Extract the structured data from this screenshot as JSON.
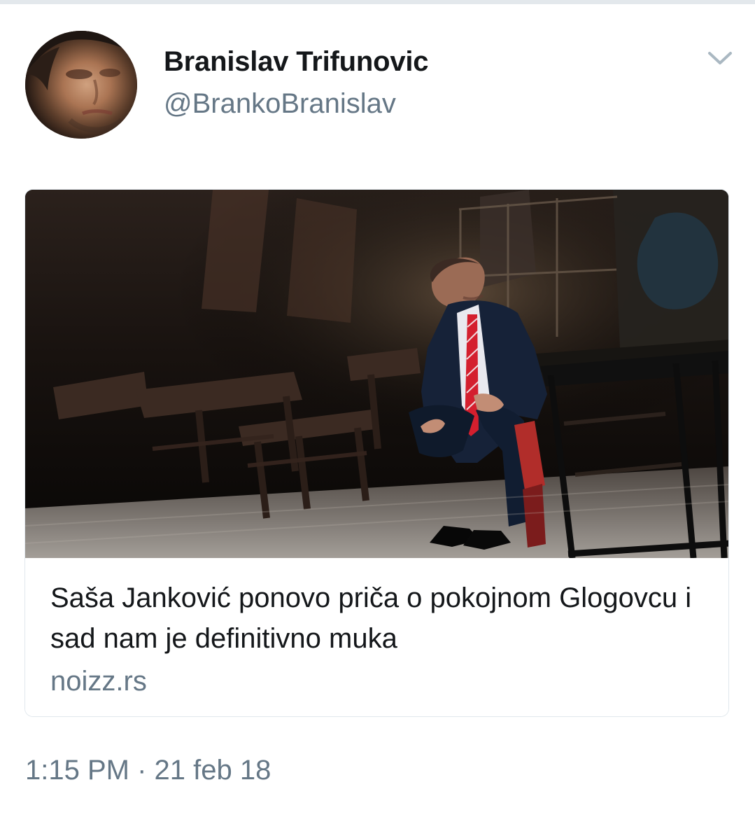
{
  "tweet": {
    "author": {
      "name": "Branislav Trifunovic",
      "handle": "@BrankoBranislav",
      "avatar_icon": "user-avatar"
    },
    "menu_icon": "chevron-down-icon",
    "link_card": {
      "title": "Saša Janković ponovo priča o pokojnom Glogovcu i sad nam je definitivno muka",
      "domain": "noizz.rs",
      "image_icon": "article-photo"
    },
    "timestamp": "1:15 PM · 21 feb 18"
  }
}
